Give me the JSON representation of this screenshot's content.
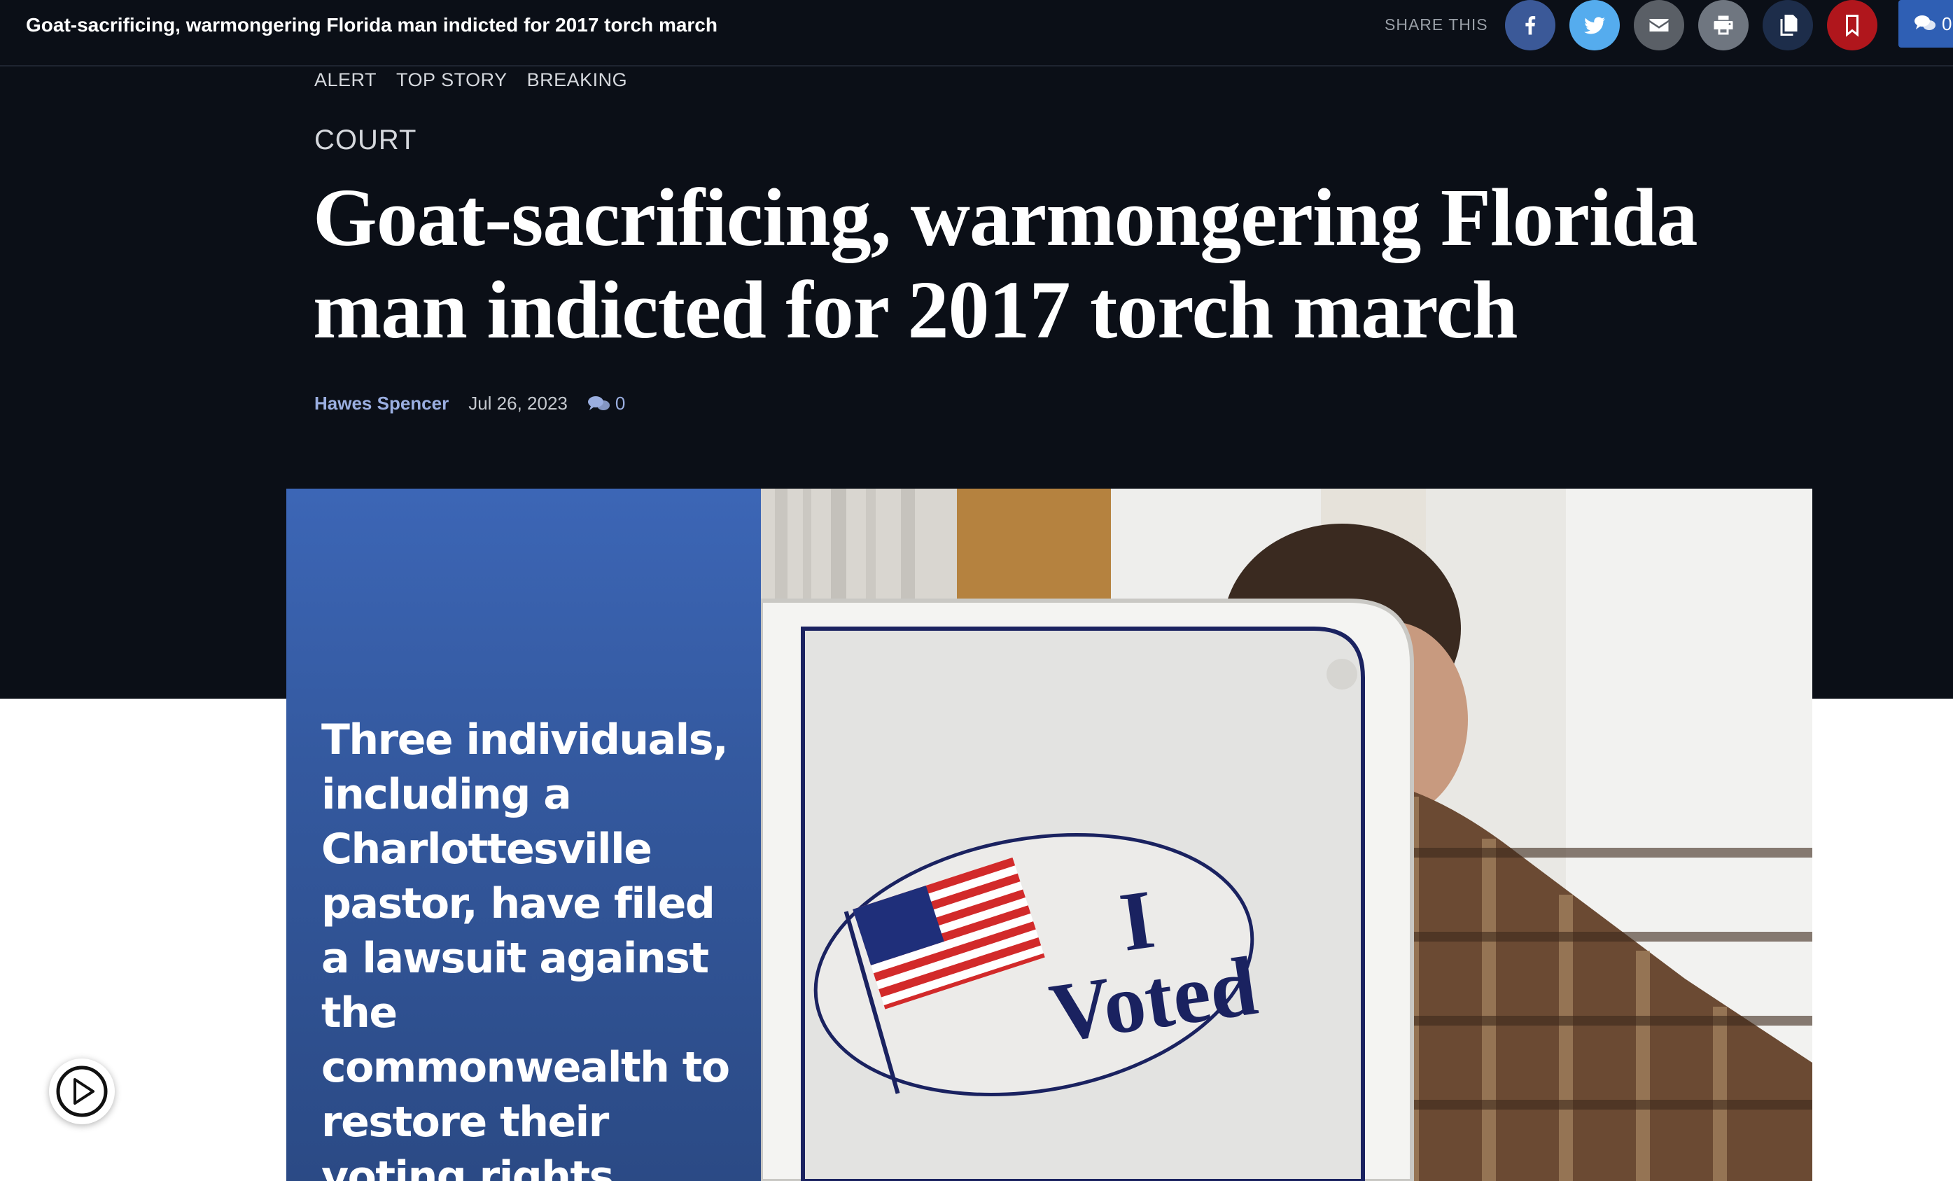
{
  "topbar": {
    "title": "Goat-sacrificing, warmongering Florida man indicted for 2017 torch march",
    "share_label": "SHARE THIS",
    "share_buttons": [
      {
        "name": "facebook",
        "icon": "facebook-icon",
        "color": "#3b5998"
      },
      {
        "name": "twitter",
        "icon": "twitter-icon",
        "color": "#55acee"
      },
      {
        "name": "email",
        "icon": "envelope-icon",
        "color": "#5a5f66"
      },
      {
        "name": "print",
        "icon": "printer-icon",
        "color": "#6f7680"
      },
      {
        "name": "copy",
        "icon": "copy-icon",
        "color": "#1d2d4a"
      },
      {
        "name": "bookmark",
        "icon": "bookmark-icon",
        "color": "#b0161c"
      }
    ],
    "comments_count": "0"
  },
  "article": {
    "flags": [
      "ALERT",
      "TOP STORY",
      "BREAKING"
    ],
    "section": "COURT",
    "headline": "Goat-sacrificing, warmongering Florida man indicted for 2017 torch march",
    "author": "Hawes Spencer",
    "date": "Jul 26, 2023",
    "comments_count": "0"
  },
  "hero": {
    "caption": "Three individuals, including a Charlottesville pastor, have filed a lawsuit against the commonwealth to restore their voting rights",
    "sticker_text_line1": "I",
    "sticker_text_line2": "Voted"
  },
  "colors": {
    "page_dark": "#0b0f17",
    "accent_blue": "#2f5fb4",
    "author_link": "#9aaee0"
  }
}
